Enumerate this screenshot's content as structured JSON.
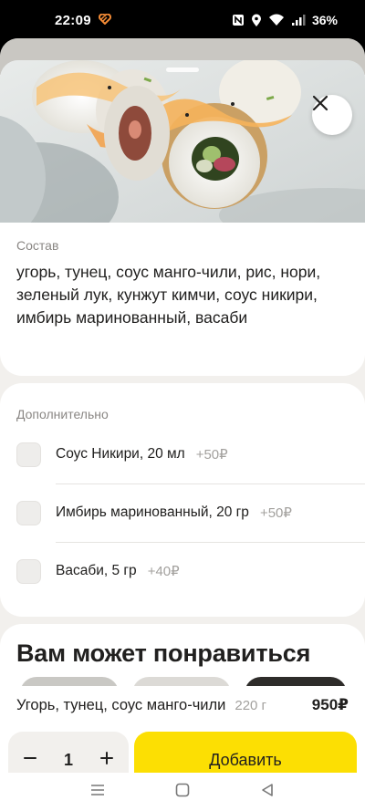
{
  "status_bar": {
    "time": "22:09",
    "battery": "36%",
    "icons": [
      "heart-app-icon",
      "nfc-icon",
      "location-icon",
      "wifi-icon",
      "signal-icon"
    ]
  },
  "product_image": {
    "description_icon": "sushi-roll-photo"
  },
  "composition": {
    "label": "Состав",
    "text": "угорь, тунец, соус манго-чили, рис, нори, зеленый лук, кунжут кимчи, соус никири, имбирь маринованный, васаби"
  },
  "extras": {
    "title": "Дополнительно",
    "options": [
      {
        "name": "Соус Никири, 20 мл",
        "price": "+50₽",
        "checked": false
      },
      {
        "name": "Имбирь маринованный, 20 гр",
        "price": "+50₽",
        "checked": false
      },
      {
        "name": "Васаби, 5 гр",
        "price": "+40₽",
        "checked": false
      }
    ]
  },
  "recommendations": {
    "title": "Вам может понравиться"
  },
  "summary": {
    "name": "Угорь, тунец, соус манго-чили",
    "weight": "220 г",
    "price": "950₽"
  },
  "cart": {
    "quantity": "1",
    "add_label": "Добавить"
  },
  "colors": {
    "accent": "#fcdf03",
    "sheet_bg": "#f2f0ed",
    "card_bg": "#ffffff",
    "muted_text": "#8a8784"
  }
}
